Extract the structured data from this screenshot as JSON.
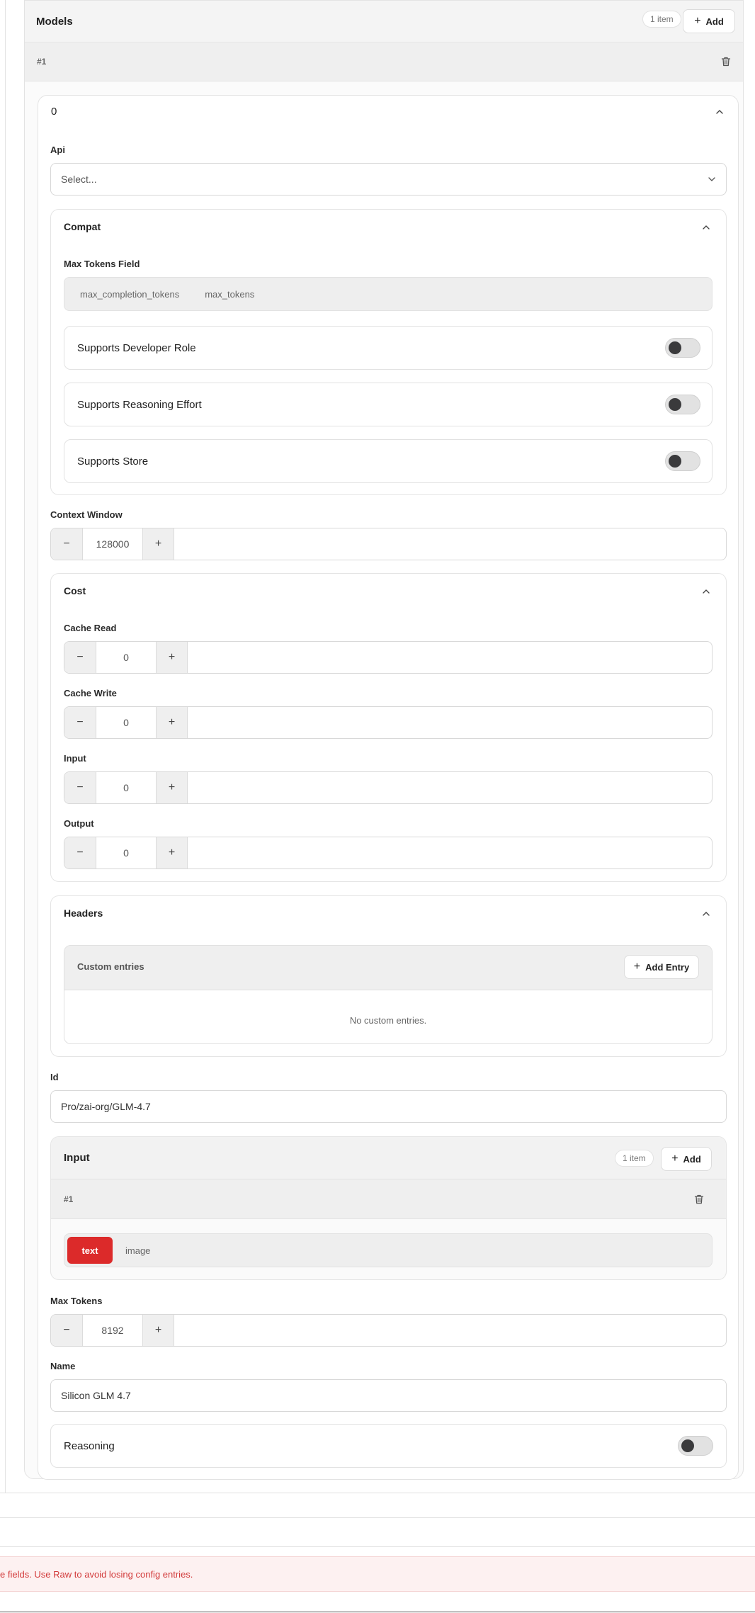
{
  "models": {
    "title": "Models",
    "count": "1 item",
    "add_label": "Add",
    "item_index": "#1",
    "entry": {
      "name_header": "0",
      "api": {
        "label": "Api",
        "placeholder": "Select..."
      },
      "compat": {
        "title": "Compat",
        "max_tokens_field": {
          "label": "Max Tokens Field",
          "options": [
            "max_completion_tokens",
            "max_tokens"
          ]
        },
        "toggles": [
          {
            "label": "Supports Developer Role",
            "on": false
          },
          {
            "label": "Supports Reasoning Effort",
            "on": false
          },
          {
            "label": "Supports Store",
            "on": false
          }
        ]
      },
      "context_window": {
        "label": "Context Window",
        "value": "128000"
      },
      "cost": {
        "title": "Cost",
        "fields": [
          {
            "label": "Cache Read",
            "value": "0"
          },
          {
            "label": "Cache Write",
            "value": "0"
          },
          {
            "label": "Input",
            "value": "0"
          },
          {
            "label": "Output",
            "value": "0"
          }
        ]
      },
      "headers": {
        "title": "Headers",
        "custom_label": "Custom entries",
        "add_entry_label": "Add Entry",
        "empty_text": "No custom entries."
      },
      "id": {
        "label": "Id",
        "value": "Pro/zai-org/GLM-4.7"
      },
      "input": {
        "title": "Input",
        "count": "1 item",
        "add_label": "Add",
        "item_index": "#1",
        "options": [
          "text",
          "image"
        ],
        "selected": "text"
      },
      "max_tokens": {
        "label": "Max Tokens",
        "value": "8192"
      },
      "name": {
        "label": "Name",
        "value": "Silicon GLM 4.7"
      },
      "reasoning": {
        "label": "Reasoning",
        "on": false
      }
    }
  },
  "stepper_symbols": {
    "minus": "−",
    "plus": "+"
  },
  "error_banner": {
    "text": "e fields. Use Raw to avoid losing config entries."
  },
  "colors": {
    "accent_red": "#dc2a2a",
    "error_text": "#d23b3b"
  }
}
